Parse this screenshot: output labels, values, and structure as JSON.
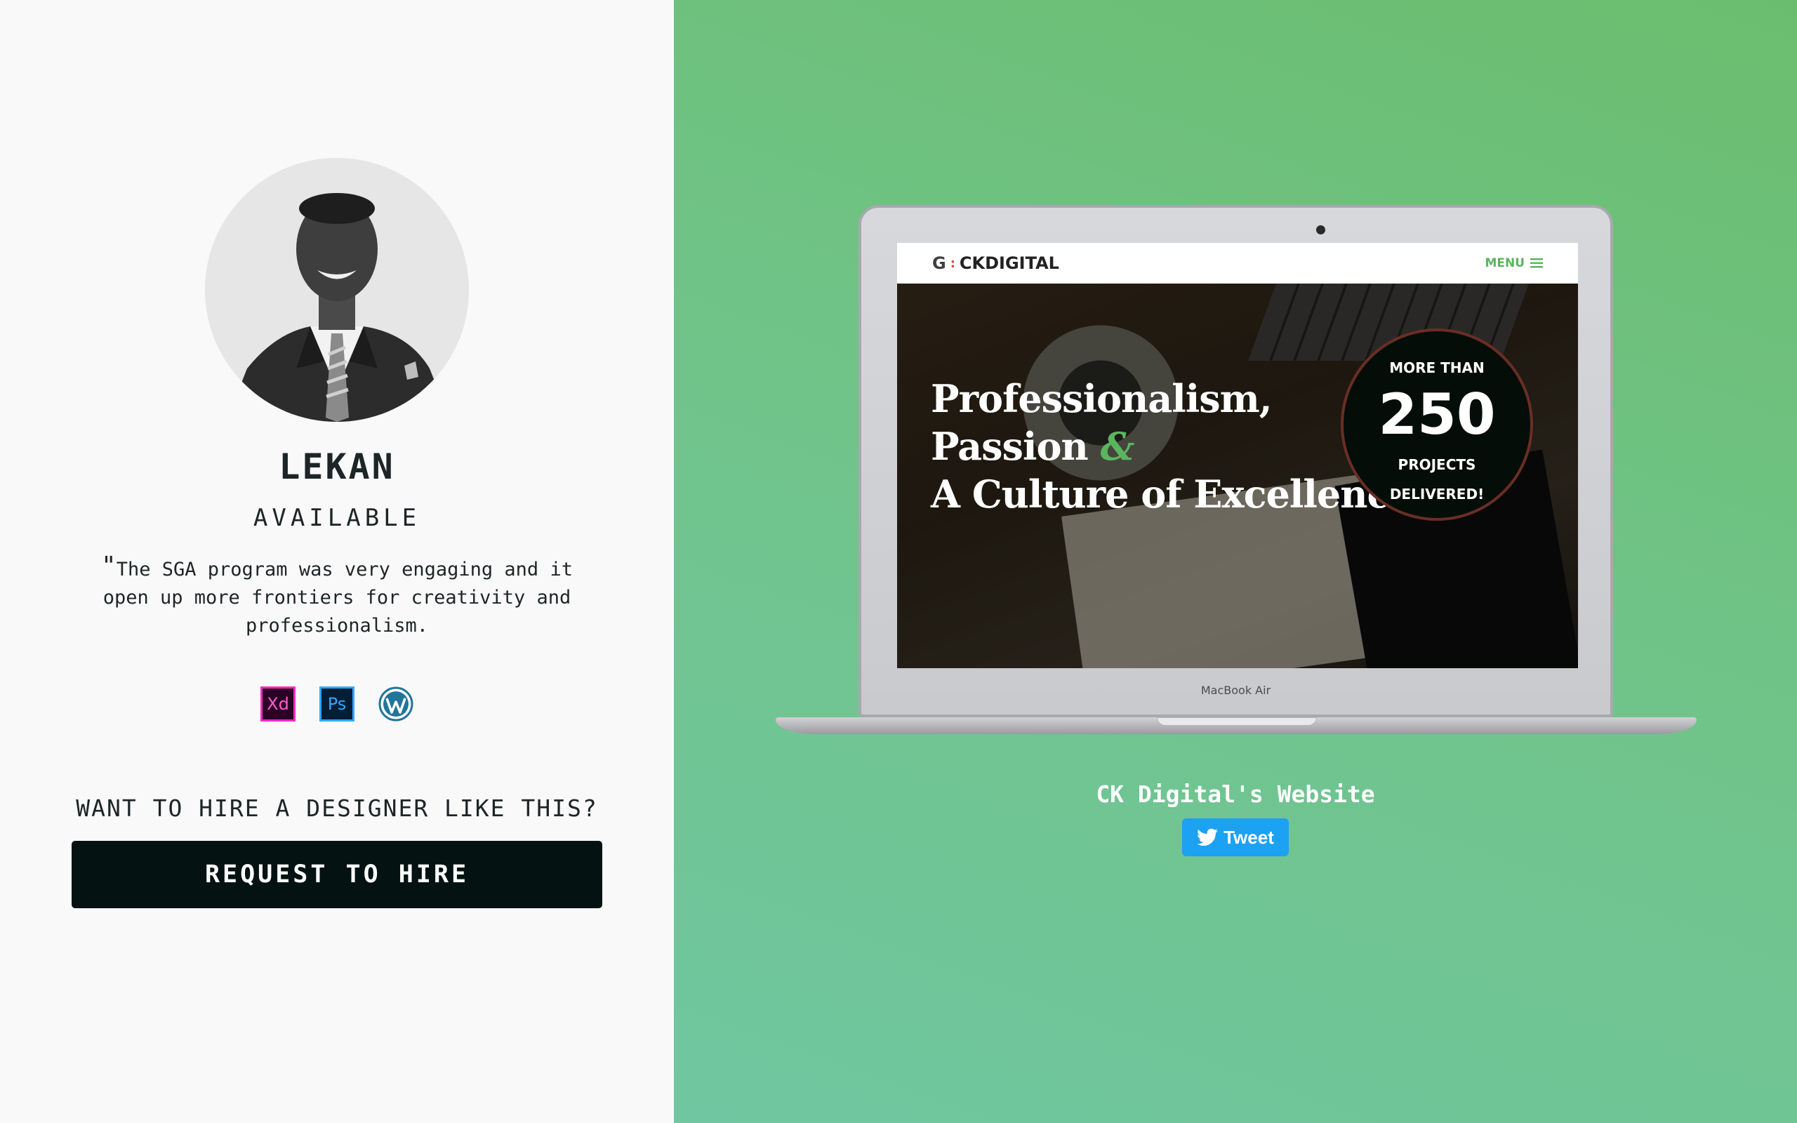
{
  "profile": {
    "name": "LEKAN",
    "status": "AVAILABLE",
    "quote_mark": "\"",
    "quote": "The SGA program was very engaging and it open up more frontiers for creativity and professionalism.",
    "tools": [
      {
        "icon": "adobe-xd-icon",
        "label": "Xd"
      },
      {
        "icon": "photoshop-icon",
        "label": "Ps"
      },
      {
        "icon": "wordpress-icon",
        "label": ""
      }
    ]
  },
  "hire": {
    "question": "WANT TO HIRE A DESIGNER LIKE THIS?",
    "button_label": "REQUEST TO HIRE"
  },
  "project": {
    "device_label": "MacBook Air",
    "site": {
      "brand": "CKDIGITAL",
      "brand_mark": "G",
      "menu_label": "MENU",
      "headline_line1": "Professionalism,",
      "headline_line2": "Passion",
      "headline_amp": "&",
      "headline_line3": "A Culture of Excellence",
      "badge_top": "MORE THAN",
      "badge_number": "250",
      "badge_mid": "PROJECTS",
      "badge_bottom": "DELIVERED!"
    },
    "title": "CK Digital's Website",
    "tweet_label": "Tweet"
  },
  "colors": {
    "left_bg": "#f9f9f9",
    "right_bg": "#6fc180",
    "button_bg": "#041212",
    "accent_green": "#5bb55f",
    "twitter_blue": "#1da1f2"
  }
}
